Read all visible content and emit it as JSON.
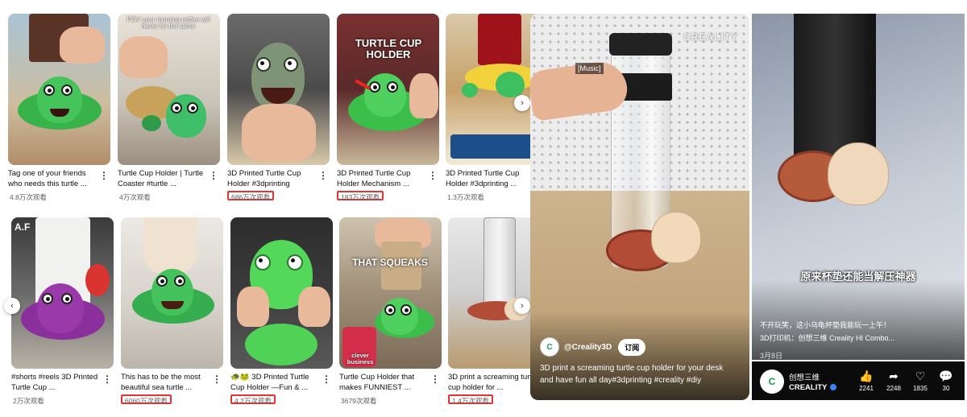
{
  "cards": [
    {
      "title": "Tag one of your friends who needs this turtle ...",
      "views": "4.8万次观看",
      "highlight": false
    },
    {
      "title": "Turtle Cup Holder | Turtle Coaster #turtle ...",
      "views": "4万次观看",
      "highlight": false,
      "overlay": "POV your morning coffee will never be the same"
    },
    {
      "title": "3D Printed Turtle Cup Holder #3dprinting",
      "views": "686万次观看",
      "highlight": true
    },
    {
      "title": "3D Printed Turtle Cup Holder Mechanism ...",
      "views": "183万次观看",
      "highlight": true,
      "overlay": "TURTLE CUP HOLDER"
    },
    {
      "title": "3D Printed Turtle Cup Holder #3dprinting ...",
      "views": "1.3万次观看",
      "highlight": false
    },
    {
      "title": "#shorts #reels 3D Printed Turtle Cup ...",
      "views": "2万次观看",
      "highlight": false,
      "overlay": "A.F"
    },
    {
      "title": "This has to be the most beautiful sea turtle ...",
      "views": "6060万次观看",
      "highlight": true
    },
    {
      "title": "🐢🐸 3D Printed Turtle Cup Holder —Fun & ...",
      "views": "4.2万次观看",
      "highlight": true
    },
    {
      "title": "Turtle Cup Holder that makes FUNNIEST ...",
      "views": "3679次观看",
      "highlight": false,
      "overlay": "THAT SQUEAKS",
      "overlay2": "clever business"
    },
    {
      "title": "3D print a screaming turtle cup holder for ...",
      "views": "1.4万次观看",
      "highlight": true
    }
  ],
  "nav": {
    "prev": "‹",
    "next": "›"
  },
  "video_main": {
    "music_tag": "[Music]",
    "watermark": "CREALITY",
    "channel": "@Creality3D",
    "subscribe": "订阅",
    "caption": "3D print a screaming turtle cup holder for your desk and have fun all day#3dprinting #creality #diy",
    "logo_text": "C"
  },
  "video_right": {
    "big_caption": "原来杯垫还能当解压神器",
    "desc_line1": "不开玩笑，这小乌龟杯垫我能玩一上午！",
    "desc_line2": "3D打印机：创想三维 Creality HI Combo...",
    "date": "3月8日",
    "channel_cn": "创想三维",
    "channel_en": "CREALITY",
    "logo_text": "C",
    "stats": [
      {
        "icon": "thumbs-up-icon",
        "glyph": "👍",
        "value": "2241"
      },
      {
        "icon": "share-icon",
        "glyph": "➦",
        "value": "2248"
      },
      {
        "icon": "heart-icon",
        "glyph": "♡",
        "value": "1835"
      },
      {
        "icon": "comment-icon",
        "glyph": "💬",
        "value": "30"
      }
    ]
  },
  "colors": {
    "highlight": "#e33333",
    "creality_green": "#1a9b4a"
  }
}
